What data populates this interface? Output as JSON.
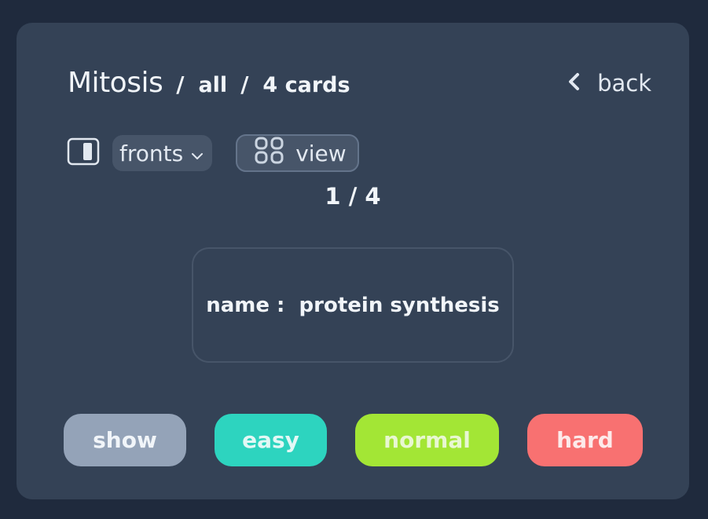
{
  "deck": {
    "title": "Mitosis",
    "separator_1": "/",
    "filter": "all",
    "separator_2": "/",
    "count_label": "4 cards"
  },
  "nav": {
    "back_label": "back",
    "back_icon": "chevron-left-icon"
  },
  "toolbar": {
    "side_toggle_icon": "split-panel-icon",
    "side_select": {
      "selected": "fronts",
      "icon": "chevron-down-icon"
    },
    "view_button": {
      "label": "view",
      "icon": "grid-icon"
    }
  },
  "progress": {
    "current": 1,
    "total": 4,
    "label": "1 / 4"
  },
  "card": {
    "front_text": "name :  protein synthesis"
  },
  "actions": [
    {
      "id": "show",
      "label": "show",
      "color": "#94a3b8",
      "text_color": "#f1f5f9"
    },
    {
      "id": "easy",
      "label": "easy",
      "color": "#2dd4bf",
      "text_color": "#e2f8f5"
    },
    {
      "id": "normal",
      "label": "normal",
      "color": "#a3e635",
      "text_color": "#e8f7d2"
    },
    {
      "id": "hard",
      "label": "hard",
      "color": "#f87171",
      "text_color": "#fdeaea"
    }
  ],
  "colors": {
    "background": "#1f2a3d",
    "panel": "#344256",
    "control": "#475569",
    "border": "#64748b",
    "text": "#f1f5f9"
  }
}
